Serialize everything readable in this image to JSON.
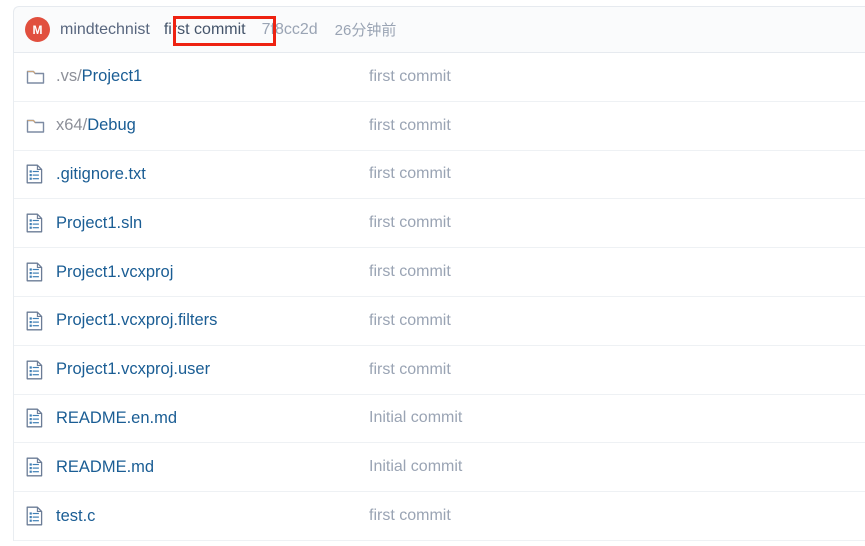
{
  "header": {
    "avatar_initial": "M",
    "avatar_color": "#e14f3e",
    "author": "mindtechnist",
    "commit_message": "first commit",
    "commit_hash": "7f8cc2d",
    "commit_time": "26分钟前",
    "annotation_color": "#ee2211"
  },
  "files": [
    {
      "icon": "folder-icon",
      "type": "folder",
      "name_prefix": ".vs/",
      "name_main": "Project1",
      "commit": "first commit"
    },
    {
      "icon": "folder-icon",
      "type": "folder",
      "name_prefix": "x64/",
      "name_main": "Debug",
      "commit": "first commit"
    },
    {
      "icon": "file-icon",
      "type": "file",
      "name_prefix": "",
      "name_main": ".gitignore.txt",
      "commit": "first commit"
    },
    {
      "icon": "file-icon",
      "type": "file",
      "name_prefix": "",
      "name_main": "Project1.sln",
      "commit": "first commit"
    },
    {
      "icon": "file-icon",
      "type": "file",
      "name_prefix": "",
      "name_main": "Project1.vcxproj",
      "commit": "first commit"
    },
    {
      "icon": "file-icon",
      "type": "file",
      "name_prefix": "",
      "name_main": "Project1.vcxproj.filters",
      "commit": "first commit"
    },
    {
      "icon": "file-icon",
      "type": "file",
      "name_prefix": "",
      "name_main": "Project1.vcxproj.user",
      "commit": "first commit"
    },
    {
      "icon": "file-icon",
      "type": "file",
      "name_prefix": "",
      "name_main": "README.en.md",
      "commit": "Initial commit"
    },
    {
      "icon": "file-icon",
      "type": "file",
      "name_prefix": "",
      "name_main": "README.md",
      "commit": "Initial commit"
    },
    {
      "icon": "file-icon",
      "type": "file",
      "name_prefix": "",
      "name_main": "test.c",
      "commit": "first commit"
    }
  ]
}
